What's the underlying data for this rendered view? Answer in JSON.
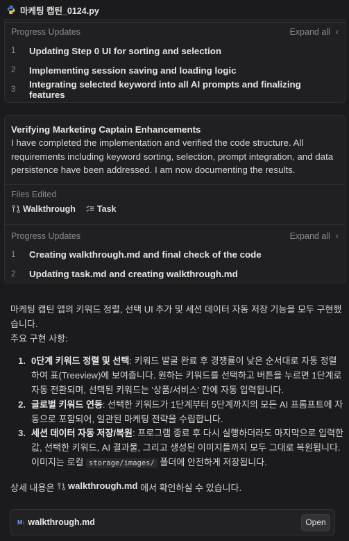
{
  "file_header": {
    "name": "마케팅 캡틴_0124.py",
    "icon": "python-icon"
  },
  "progress1": {
    "label": "Progress Updates",
    "expand_label": "Expand all",
    "steps": [
      {
        "num": "1",
        "text": "Updating Step 0 UI for sorting and selection"
      },
      {
        "num": "2",
        "text": "Implementing session saving and loading logic"
      },
      {
        "num": "3",
        "text": "Integrating selected keyword into all AI prompts and finalizing features"
      }
    ]
  },
  "task": {
    "title": "Verifying Marketing Captain Enhancements",
    "body": "I have completed the implementation and verified the code structure. All requirements including keyword sorting, selection, prompt integration, and data persistence have been addressed. I am now documenting the results.",
    "files_label": "Files Edited",
    "files": [
      {
        "name": "Walkthrough",
        "icon": "git-diff-icon"
      },
      {
        "name": "Task",
        "icon": "checklist-icon"
      }
    ]
  },
  "progress2": {
    "label": "Progress Updates",
    "expand_label": "Expand all",
    "steps": [
      {
        "num": "1",
        "text": "Creating walkthrough.md and final check of the code"
      },
      {
        "num": "2",
        "text": "Updating task.md and creating walkthrough.md"
      }
    ]
  },
  "summary": {
    "intro": "마케팅 캡틴 앱의 키워드 정렬, 선택 UI 추가 및 세션 데이터 자동 저장 기능을 모두 구현했습니다.",
    "subheading": "주요 구현 사항:",
    "items": [
      {
        "num": "1.",
        "title": "0단계 키워드 정렬 및 선택",
        "text": ": 키워드 발굴 완료 후 경쟁률이 낮은 순서대로 자동 정렬하여 표(Treeview)에 보여줍니다. 원하는 키워드를 선택하고 버튼을 누르면 1단계로 자동 전환되며, 선택된 키워드는 '상품/서비스' 칸에 자동 입력됩니다."
      },
      {
        "num": "2.",
        "title": "글로벌 키워드 연동",
        "text": ": 선택한 키워드가 1단계부터 5단계까지의 모든 AI 프롬프트에 자동으로 포함되어, 일관된 마케팅 전략을 수립합니다."
      },
      {
        "num": "3.",
        "title": "세션 데이터 자동 저장/복원",
        "text": ": 프로그램 종료 후 다시 실행하더라도 마지막으로 입력한 값, 선택한 키워드, AI 결과물, 그리고 생성된 이미지들까지 모두 그대로 복원됩니다. 이미지는 로컬",
        "code": "storage/images/",
        "text_after": "폴더에 안전하게 저장됩니다."
      }
    ],
    "detail_prefix": "상세 내용은",
    "detail_link": "walkthrough.md",
    "detail_suffix": "에서 확인하실 수 있습니다."
  },
  "attachment": {
    "name": "walkthrough.md",
    "icon_text": "M↓",
    "open_label": "Open"
  }
}
